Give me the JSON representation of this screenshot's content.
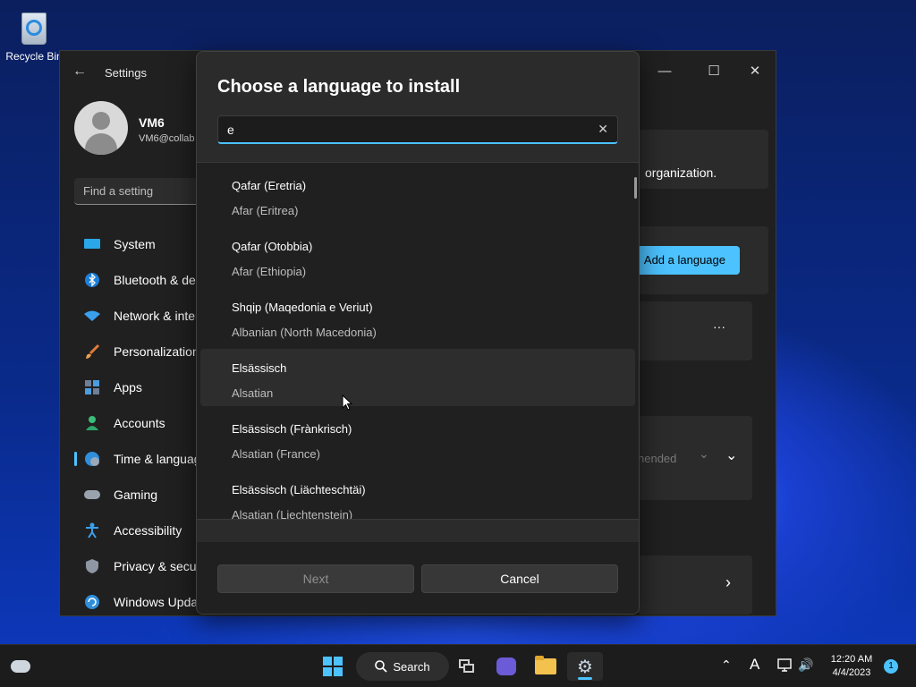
{
  "desktop": {
    "recycle_bin_label": "Recycle Bin"
  },
  "settings": {
    "title": "Settings",
    "back_glyph": "←",
    "window_controls": {
      "minimize": "—",
      "maximize": "☐",
      "close": "✕"
    },
    "user": {
      "name": "VM6",
      "email": "VM6@collab"
    },
    "search_placeholder": "Find a setting",
    "nav": [
      {
        "label": "System",
        "icon": "monitor-icon"
      },
      {
        "label": "Bluetooth & devices",
        "icon": "bluetooth-icon"
      },
      {
        "label": "Network & internet",
        "icon": "wifi-icon"
      },
      {
        "label": "Personalization",
        "icon": "brush-icon"
      },
      {
        "label": "Apps",
        "icon": "apps-icon"
      },
      {
        "label": "Accounts",
        "icon": "person-icon"
      },
      {
        "label": "Time & language",
        "icon": "globe-clock-icon",
        "active": true
      },
      {
        "label": "Gaming",
        "icon": "gamepad-icon"
      },
      {
        "label": "Accessibility",
        "icon": "accessibility-icon"
      },
      {
        "label": "Privacy & security",
        "icon": "shield-icon"
      },
      {
        "label": "Windows Update",
        "icon": "update-icon"
      }
    ],
    "right_panel": {
      "organization_text": "organization.",
      "add_language_label": "Add a language",
      "more_glyph": "···",
      "recommended_fragment": "nended",
      "dropdown_glyph": "⌄",
      "chevron_glyph": "›"
    }
  },
  "dialog": {
    "title": "Choose a language to install",
    "search_value": "e",
    "clear_glyph": "✕",
    "languages": [
      {
        "native": "Qafar (Eretria)",
        "english": "Afar (Eritrea)"
      },
      {
        "native": "Qafar (Otobbia)",
        "english": "Afar (Ethiopia)"
      },
      {
        "native": "Shqip (Maqedonia e Veriut)",
        "english": "Albanian (North Macedonia)"
      },
      {
        "native": "Elsässisch",
        "english": "Alsatian"
      },
      {
        "native": "Elsässisch (Frànkrisch)",
        "english": "Alsatian (France)"
      },
      {
        "native": "Elsässisch (Liächteschtäi)",
        "english": "Alsatian (Liechtenstein)"
      }
    ],
    "next_label": "Next",
    "cancel_label": "Cancel"
  },
  "taskbar": {
    "search_label": "Search",
    "clock_time": "12:20 AM",
    "clock_date": "4/4/2023",
    "notification_count": "1",
    "tray": {
      "chevron": "⌃",
      "ime": "A",
      "volume": "🔊"
    }
  },
  "colors": {
    "accent": "#4cc2ff",
    "dialog_bg": "#2b2b2b",
    "window_bg": "#202020",
    "taskbar_bg": "#1c1c1c"
  }
}
